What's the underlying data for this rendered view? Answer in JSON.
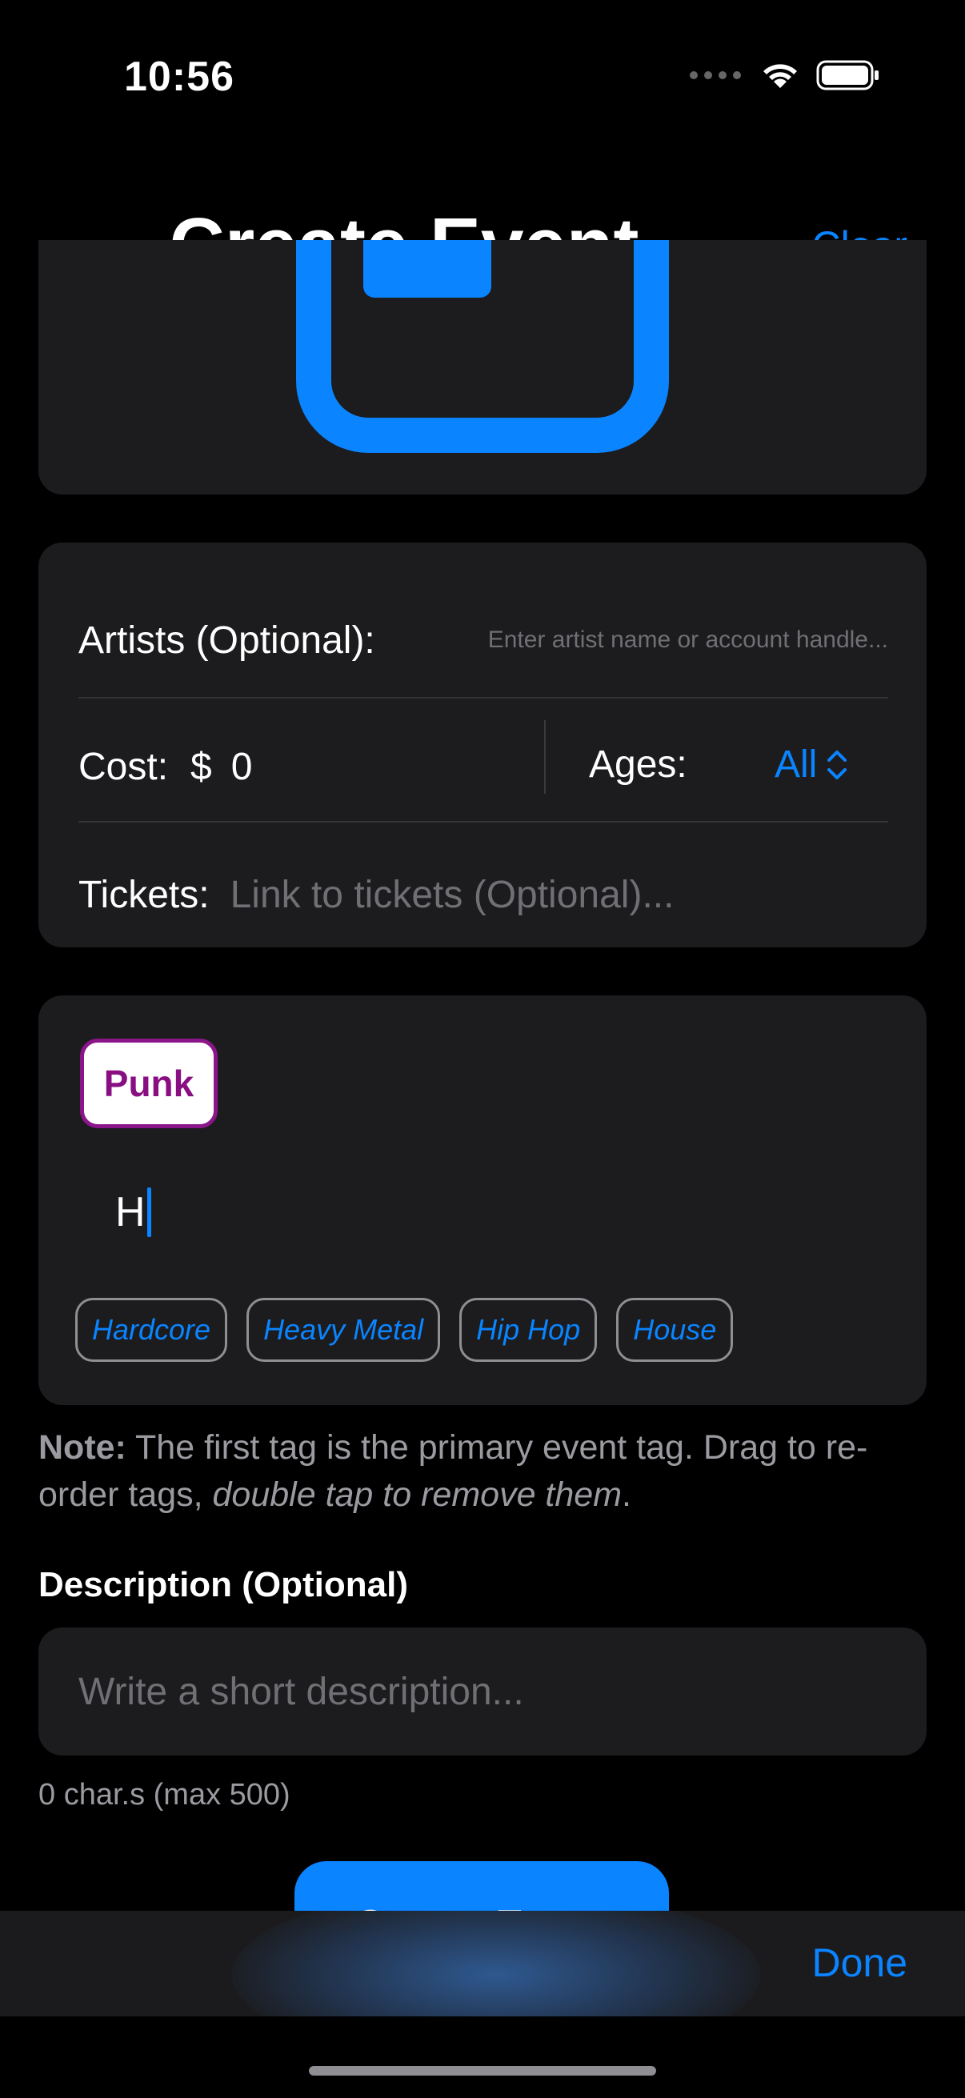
{
  "status_bar": {
    "time": "10:56"
  },
  "nav": {
    "title": "Create Event",
    "clear_label": "Clear"
  },
  "details": {
    "artists_label": "Artists (Optional):",
    "artists_placeholder": "Enter artist name or account handle...",
    "cost_label": "Cost:",
    "currency_symbol": "$",
    "cost_value": "0",
    "ages_label": "Ages:",
    "ages_value": "All",
    "tickets_label": "Tickets:",
    "tickets_placeholder": "Link to tickets (Optional)..."
  },
  "tags": {
    "selected": [
      "Punk"
    ],
    "input_value": "H",
    "suggestions": [
      "Hardcore",
      "Heavy Metal",
      "Hip Hop",
      "House"
    ]
  },
  "note": {
    "prefix": "Note:",
    "text": " The first tag is the primary event tag. Drag to re-order tags, ",
    "emphasis": "double tap to remove them",
    "suffix": "."
  },
  "description": {
    "label": "Description (Optional)",
    "placeholder": "Write a short description...",
    "char_count": "0 char.s (max 500)"
  },
  "create_button": {
    "label": "Create Event"
  },
  "toolbar": {
    "done_label": "Done"
  },
  "colors": {
    "accent": "#0a84ff",
    "tag_primary": "#880e82",
    "card": "#1c1c1e"
  },
  "icons": [
    "wifi-icon",
    "battery-icon",
    "chevron-up-down-icon",
    "image-icon"
  ]
}
